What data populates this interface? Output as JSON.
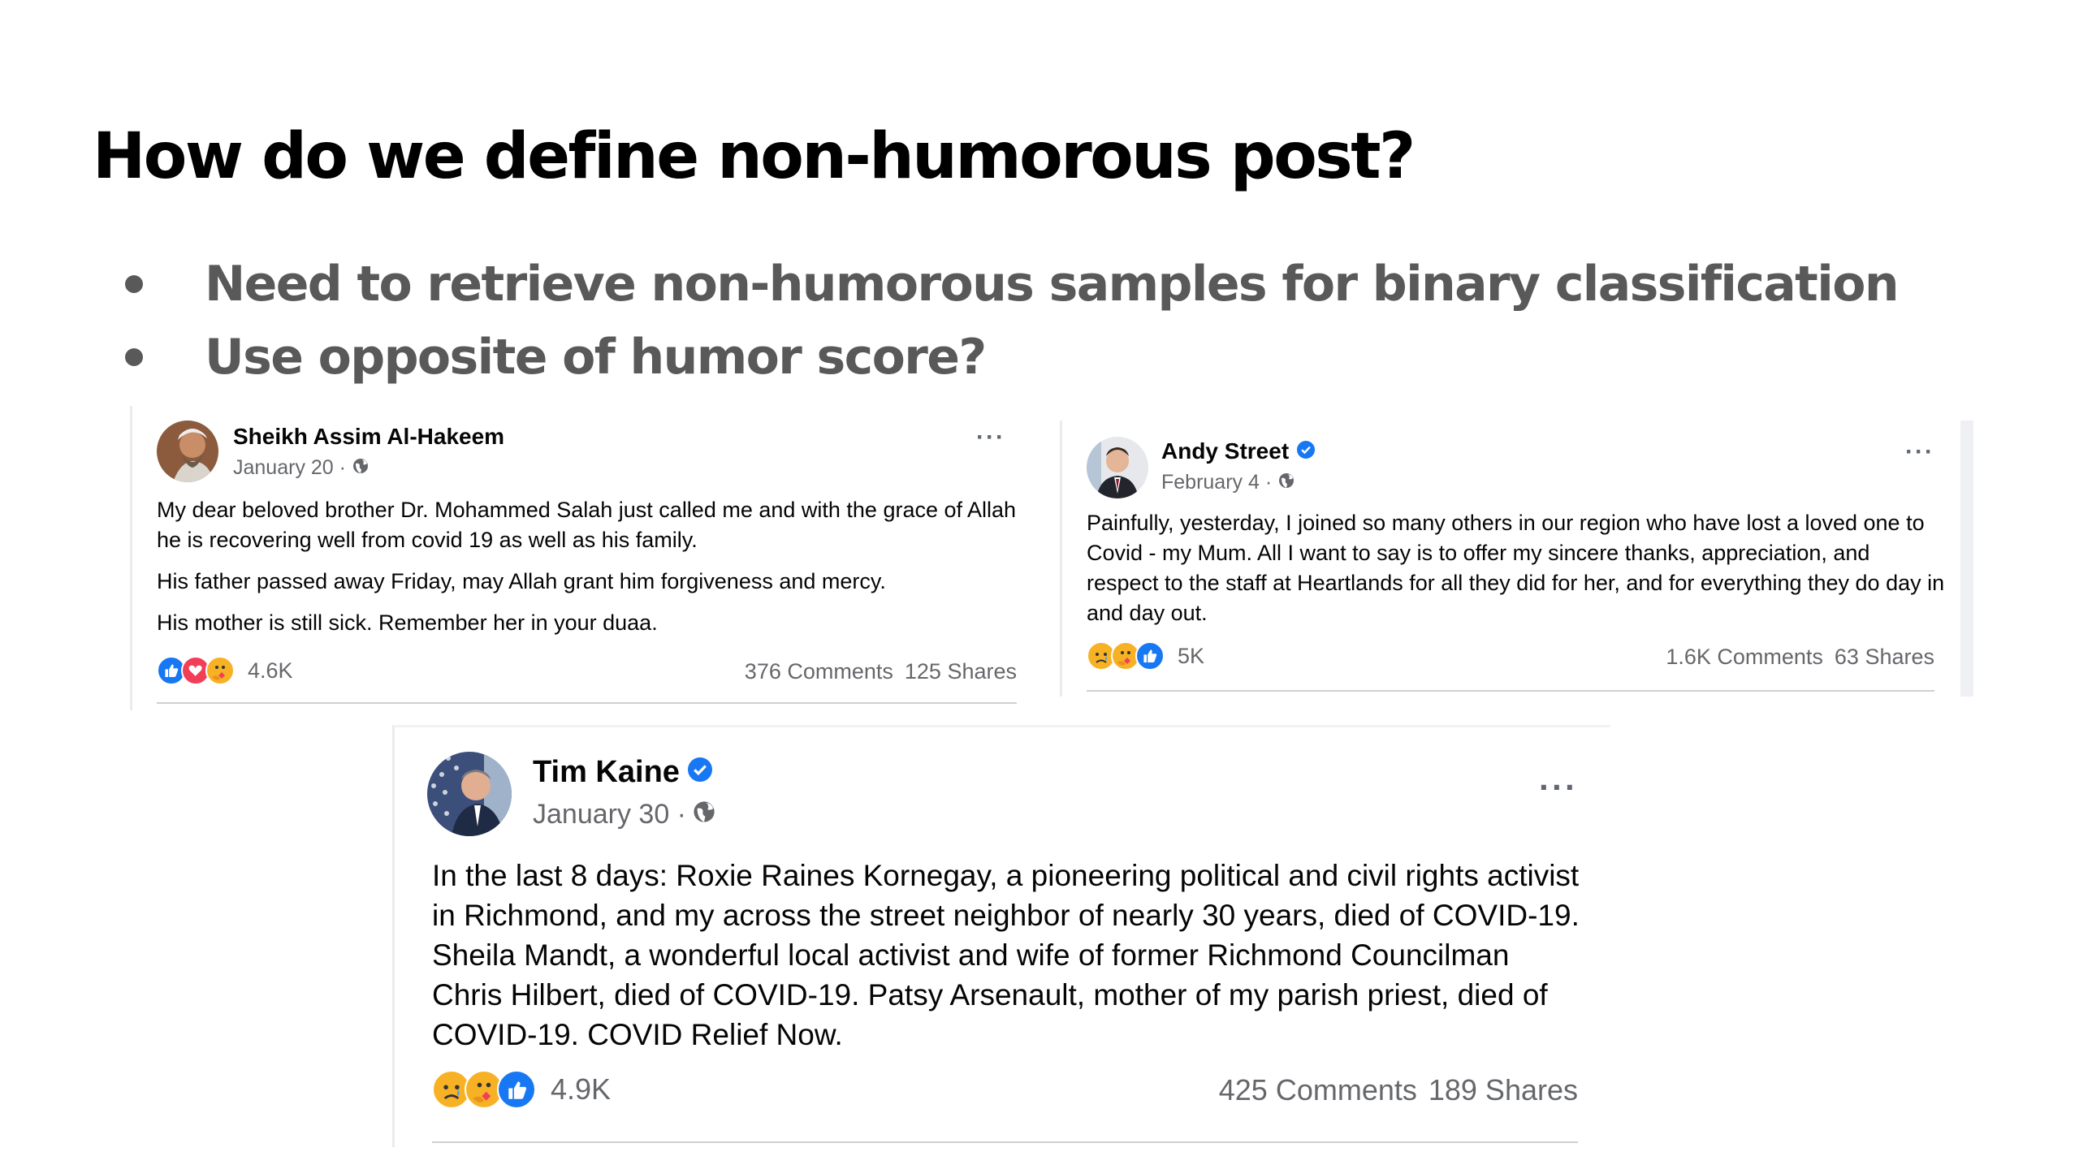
{
  "slide": {
    "title": "How do we define non-humorous post?",
    "bullets": [
      "Need to retrieve non-humorous samples for binary classification",
      "Use opposite of humor score?"
    ]
  },
  "posts": [
    {
      "author": "Sheikh Assim Al-Hakeem",
      "verified": false,
      "date": "January 20 ·",
      "paragraphs": [
        "My dear beloved brother Dr. Mohammed Salah just called me and with the grace of Allah he is recovering well from covid 19 as well as his family.",
        "His father passed away Friday, may Allah grant him forgiveness and mercy.",
        "His mother is still sick. Remember her in your duaa."
      ],
      "reactions": [
        "like-icon",
        "love-icon",
        "care-icon"
      ],
      "reaction_count": "4.6K",
      "comments": "376 Comments",
      "shares": "125 Shares",
      "more": "···"
    },
    {
      "author": "Andy Street",
      "verified": true,
      "date": "February 4 ·",
      "paragraphs": [
        "Painfully, yesterday, I joined so many others in our region who have lost a loved one to Covid - my Mum. All I want to say is to offer my sincere thanks, appreciation, and respect to the staff at Heartlands for all they did for her, and for everything they do day in and day out."
      ],
      "reactions": [
        "sad-icon",
        "care-icon",
        "like-icon"
      ],
      "reaction_count": "5K",
      "comments": "1.6K Comments",
      "shares": "63 Shares",
      "more": "···"
    },
    {
      "author": "Tim Kaine",
      "verified": true,
      "date": "January 30 ·",
      "paragraphs": [
        "In the last 8 days: Roxie Raines Kornegay, a pioneering political and civil rights activist in Richmond, and my across the street neighbor of nearly 30 years, died of COVID-19. Sheila Mandt, a wonderful local activist and wife of former Richmond Councilman Chris Hilbert, died of COVID-19. Patsy Arsenault, mother of my parish priest, died of COVID-19. COVID Relief Now."
      ],
      "reactions": [
        "sad-icon",
        "care-icon",
        "like-icon"
      ],
      "reaction_count": "4.9K",
      "comments": "425 Comments",
      "shares": "189 Shares",
      "more": "···"
    }
  ],
  "colors": {
    "like": "#1877f2",
    "love": "#f33e58",
    "emoji": "#f7b125",
    "verified": "#1877f2",
    "secondary_text": "#65676b",
    "bullet_text": "#595959"
  }
}
